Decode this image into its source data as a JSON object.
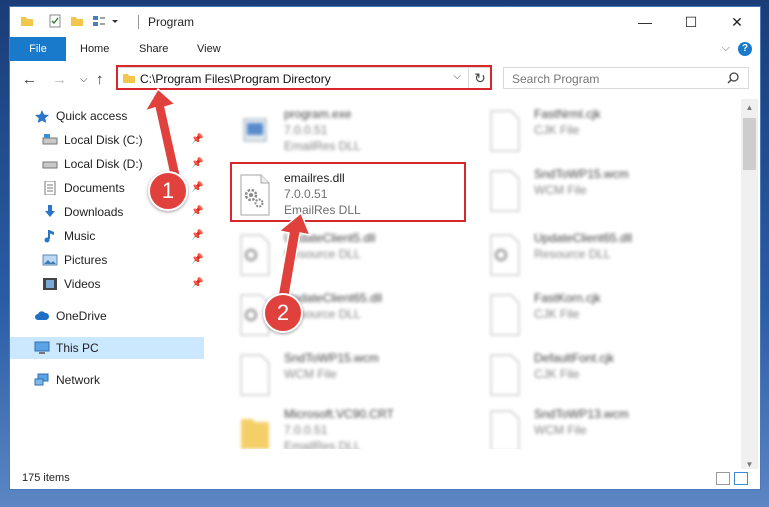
{
  "window": {
    "title": "Program",
    "controls": {
      "minimize": "—",
      "maximize": "☐",
      "close": "✕"
    }
  },
  "ribbon": {
    "file": "File",
    "home": "Home",
    "share": "Share",
    "view": "View",
    "help": "?"
  },
  "nav": {
    "address": "C:\\Program Files\\Program Directory",
    "search_placeholder": "Search Program"
  },
  "sidebar": {
    "quick_access": "Quick access",
    "items": [
      {
        "label": "Local Disk (C:)",
        "icon": "drive-icon"
      },
      {
        "label": "Local Disk (D:)",
        "icon": "drive-icon"
      },
      {
        "label": "Documents",
        "icon": "documents-icon"
      },
      {
        "label": "Downloads",
        "icon": "downloads-icon"
      },
      {
        "label": "Music",
        "icon": "music-icon"
      },
      {
        "label": "Pictures",
        "icon": "pictures-icon"
      },
      {
        "label": "Videos",
        "icon": "videos-icon"
      }
    ],
    "onedrive": "OneDrive",
    "this_pc": "This PC",
    "network": "Network"
  },
  "files": {
    "left": [
      {
        "name": "program.exe",
        "line1": "7.0.0.51",
        "line2": "EmailRes DLL"
      },
      {
        "name": "emailres.dll",
        "line1": "7.0.0.51",
        "line2": "EmailRes DLL"
      },
      {
        "name": "UpdateClient5.dll",
        "line1": "Resource DLL",
        "line2": ""
      },
      {
        "name": "UpdateClient65.dll",
        "line1": "Resource DLL",
        "line2": ""
      },
      {
        "name": "SndToWP15.wcm",
        "line1": "WCM File",
        "line2": ""
      },
      {
        "name": "Microsoft.VC90.CRT",
        "line1": "7.0.0.51",
        "line2": "EmailRes DLL"
      }
    ],
    "right": [
      {
        "name": "FastNrml.cjk",
        "line1": "CJK File"
      },
      {
        "name": "SndToWP15.wcm",
        "line1": "WCM File"
      },
      {
        "name": "UpdateClient65.dll",
        "line1": "Resource DLL"
      },
      {
        "name": "FastKorn.cjk",
        "line1": "CJK File"
      },
      {
        "name": "DefaultFont.cjk",
        "line1": "CJK File"
      },
      {
        "name": "SndToWP13.wcm",
        "line1": "WCM File"
      }
    ]
  },
  "status": {
    "count": "175 items"
  },
  "callouts": {
    "step1": "1",
    "step2": "2",
    "highlight_color": "#d7262c",
    "badge_color": "#e0413c"
  },
  "colors": {
    "accent": "#1979ca",
    "selection": "#cce8ff"
  }
}
